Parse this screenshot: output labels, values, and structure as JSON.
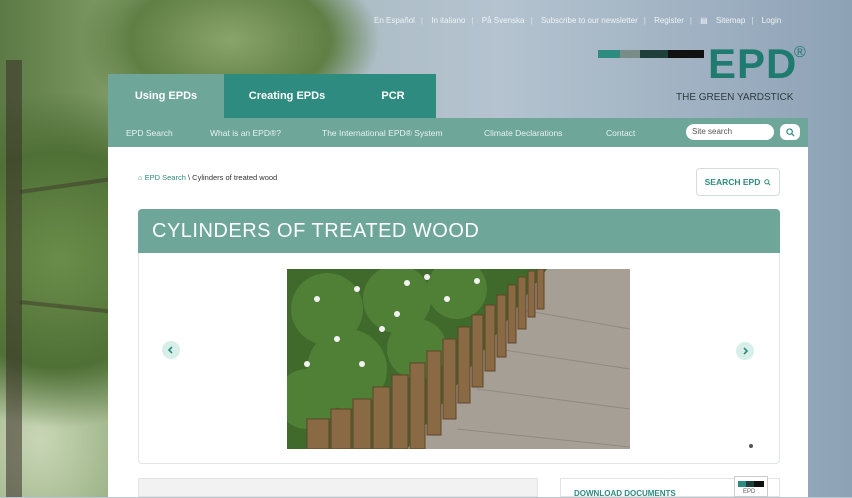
{
  "top_links": [
    "En Español",
    "In italiano",
    "På Svenska",
    "Subscribe to our newsletter",
    "Register",
    "Sitemap",
    "Login"
  ],
  "logo": {
    "text": "EPD",
    "reg": "®",
    "tagline": "THE GREEN YARDSTICK"
  },
  "tabs": [
    {
      "label": "Using EPDs"
    },
    {
      "label": "Creating EPDs"
    },
    {
      "label": "PCR"
    }
  ],
  "nav": [
    "EPD Search",
    "What is an EPD®?",
    "The International EPD® System",
    "Climate Declarations",
    "Contact"
  ],
  "search": {
    "placeholder": "Site search"
  },
  "breadcrumb": {
    "link": "EPD Search",
    "sep": " \\ ",
    "current": "Cylinders of treated wood"
  },
  "search_epd_label": "SEARCH EPD",
  "page_title": "CYLINDERS OF TREATED WOOD",
  "download_label": "DOWNLOAD DOCUMENTS",
  "doc_icon_text": "EPD",
  "colors": {
    "accent": "#6ea69a",
    "brand": "#2e8b80"
  },
  "icons": {
    "home": "home-icon",
    "search": "search-icon",
    "prev": "chevron-left-icon",
    "next": "chevron-right-icon",
    "sitemap": "sitemap-icon"
  }
}
